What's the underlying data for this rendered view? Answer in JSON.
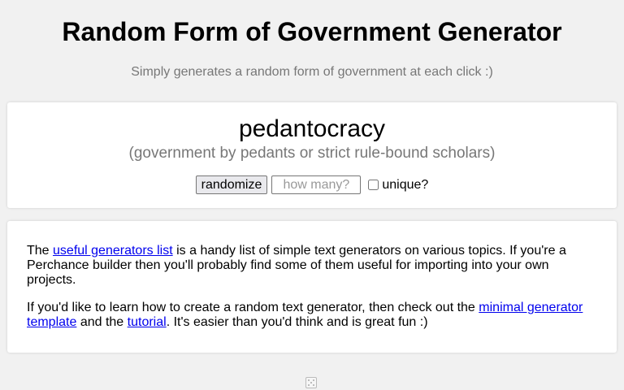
{
  "header": {
    "title": "Random Form of Government Generator",
    "subtitle": "Simply generates a random form of government at each click :)"
  },
  "result": {
    "word": "pedantocracy",
    "definition": "(government by pedants or strict rule-bound scholars)"
  },
  "controls": {
    "randomize_label": "randomize",
    "count_placeholder": "how many?",
    "count_value": "",
    "unique_label": "unique?",
    "unique_checked": false
  },
  "info": {
    "p1_before": "The ",
    "p1_link": "useful generators list",
    "p1_after": " is a handy list of simple text generators on various topics. If you're a Perchance builder then you'll probably find some of them useful for importing into your own projects.",
    "p2_before": "If you'd like to learn how to create a random text generator, then check out the ",
    "p2_link1": "minimal generator template",
    "p2_middle": " and the ",
    "p2_link2": "tutorial",
    "p2_after": ". It's easier than you'd think and is great fun :)"
  },
  "footer": {
    "icon": "dice-icon"
  },
  "colors": {
    "background": "#f1f1f1",
    "card": "#ffffff",
    "muted_text": "#777777",
    "link": "#0000ee"
  }
}
